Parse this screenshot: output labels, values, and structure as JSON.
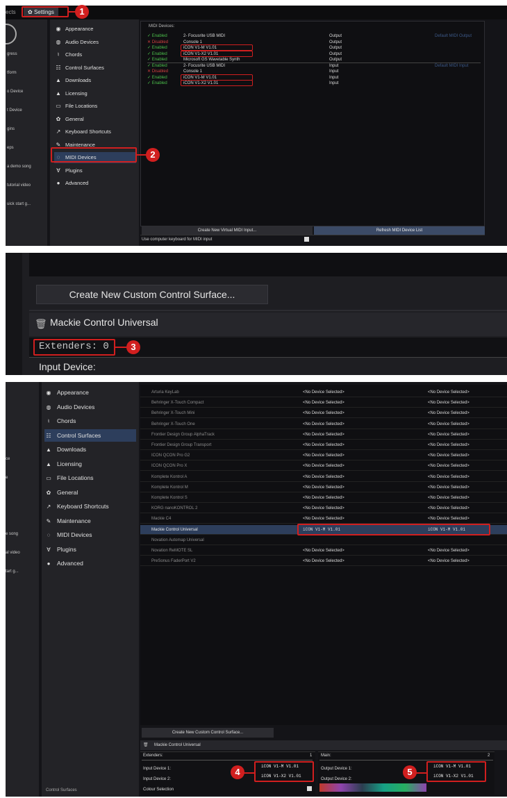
{
  "panel1": {
    "breadcrumb_frag": "ects",
    "settings_tab": "Settings",
    "left_items": [
      "gress",
      "tform",
      "o Device",
      "t Device",
      "gins",
      "eps",
      "a demo song",
      "tutorial video",
      "uick start g..."
    ],
    "menu": [
      {
        "icon": "eye-icon",
        "glyph": "◉",
        "label": "Appearance"
      },
      {
        "icon": "speaker-icon",
        "glyph": "◍",
        "label": "Audio Devices"
      },
      {
        "icon": "music-icon",
        "glyph": "♮",
        "label": "Chords"
      },
      {
        "icon": "sliders-icon",
        "glyph": "☷",
        "label": "Control Surfaces"
      },
      {
        "icon": "download-icon",
        "glyph": "▲",
        "label": "Downloads"
      },
      {
        "icon": "lock-icon",
        "glyph": "▲",
        "label": "Licensing"
      },
      {
        "icon": "folder-icon",
        "glyph": "▭",
        "label": "File Locations"
      },
      {
        "icon": "gear-icon",
        "glyph": "✿",
        "label": "General"
      },
      {
        "icon": "external-icon",
        "glyph": "↗",
        "label": "Keyboard Shortcuts"
      },
      {
        "icon": "wrench-icon",
        "glyph": "✎",
        "label": "Maintenance"
      },
      {
        "icon": "midi-icon",
        "glyph": "◌",
        "label": "MIDI Devices"
      },
      {
        "icon": "plug-icon",
        "glyph": "∀",
        "label": "Plugins"
      },
      {
        "icon": "advanced-icon",
        "glyph": "●",
        "label": "Advanced"
      }
    ],
    "midi_header": "MIDI Devices:",
    "devices": [
      {
        "status": "✓ Enabled",
        "name": "2- Focusrite USB MIDI",
        "dir": "Output",
        "extra": "Default MIDI Output",
        "ok": true
      },
      {
        "status": "✕ Disabled",
        "name": "Console 1",
        "dir": "Output",
        "extra": "",
        "ok": false
      },
      {
        "status": "✓ Enabled",
        "name": "iCON V1-M V1.01",
        "dir": "Output",
        "extra": "",
        "ok": true
      },
      {
        "status": "✓ Enabled",
        "name": "iCON V1-X2 V1.01",
        "dir": "Output",
        "extra": "",
        "ok": true
      },
      {
        "status": "✓ Enabled",
        "name": "Microsoft GS Wavetable Synth",
        "dir": "Output",
        "extra": "",
        "ok": true
      },
      {
        "status": "✓ Enabled",
        "name": "2- Focusrite USB MIDI",
        "dir": "Input",
        "extra": "Default MIDI Input",
        "ok": true
      },
      {
        "status": "✕ Disabled",
        "name": "Console 1",
        "dir": "Input",
        "extra": "",
        "ok": false
      },
      {
        "status": "✓ Enabled",
        "name": "iCON V1-M V1.01",
        "dir": "Input",
        "extra": "",
        "ok": true
      },
      {
        "status": "✓ Enabled",
        "name": "iCON V1-X2 V1.01",
        "dir": "Input",
        "extra": "",
        "ok": true
      }
    ],
    "create_virtual_btn": "Create New Virtual MIDI Input...",
    "refresh_btn": "Refresh MIDI Device List",
    "use_keyboard": "Use computer keyboard for MIDI input"
  },
  "panel2": {
    "create_surface_btn": "Create New Custom Control Surface...",
    "surface_title": "Mackie Control Universal",
    "extenders": "Extenders: 0",
    "input_device": "Input Device:"
  },
  "panel3": {
    "left_items": [
      "",
      "ce",
      "e",
      "",
      "",
      "e song",
      "al video",
      "tart g..."
    ],
    "active_menu": "Control Surfaces",
    "surfaces": [
      {
        "name": "Arturia KeyLab",
        "in": "<No Device Selected>",
        "out": "<No Device Selected>"
      },
      {
        "name": "Behringer X-Touch Compact",
        "in": "<No Device Selected>",
        "out": "<No Device Selected>"
      },
      {
        "name": "Behringer X-Touch Mini",
        "in": "<No Device Selected>",
        "out": "<No Device Selected>"
      },
      {
        "name": "Behringer X-Touch One",
        "in": "<No Device Selected>",
        "out": "<No Device Selected>"
      },
      {
        "name": "Frontier Design Group AlphaTrack",
        "in": "<No Device Selected>",
        "out": "<No Device Selected>"
      },
      {
        "name": "Frontier Design Group Transport",
        "in": "<No Device Selected>",
        "out": "<No Device Selected>"
      },
      {
        "name": "ICON QCON Pro G2",
        "in": "<No Device Selected>",
        "out": "<No Device Selected>"
      },
      {
        "name": "ICON QCON Pro X",
        "in": "<No Device Selected>",
        "out": "<No Device Selected>"
      },
      {
        "name": "Komplete Kontrol A",
        "in": "<No Device Selected>",
        "out": "<No Device Selected>"
      },
      {
        "name": "Komplete Kontrol M",
        "in": "<No Device Selected>",
        "out": "<No Device Selected>"
      },
      {
        "name": "Komplete Kontrol S",
        "in": "<No Device Selected>",
        "out": "<No Device Selected>"
      },
      {
        "name": "KORG nanoKONTROL 2",
        "in": "<No Device Selected>",
        "out": "<No Device Selected>"
      },
      {
        "name": "Mackie C4",
        "in": "<No Device Selected>",
        "out": "<No Device Selected>"
      },
      {
        "name": "Mackie Control Universal",
        "in": "iCON V1-M V1.01",
        "out": "iCON V1-M V1.01"
      },
      {
        "name": "Novation Automap Universal",
        "in": "",
        "out": ""
      },
      {
        "name": "Novation ReMOTE SL",
        "in": "<No Device Selected>",
        "out": "<No Device Selected>"
      },
      {
        "name": "PreSonus FaderPort V2",
        "in": "<No Device Selected>",
        "out": "<No Device Selected>"
      }
    ],
    "create_surface_btn": "Create New Custom Control Surface...",
    "surface_title": "Mackie Control Universal",
    "extenders_label": "Extenders:",
    "extenders_value": "1",
    "main_label": "Main:",
    "main_value": "2",
    "input1_label": "Input Device 1:",
    "input1_value": "iCON V1-M V1.01",
    "input2_label": "Input Device 2:",
    "input2_value": "iCON V1-X2 V1.01",
    "colour_label": "Colour Selection",
    "output1_label": "Output Device 1:",
    "output1_value": "iCON V1-M V1.01",
    "output2_label": "Output Device 2:",
    "output2_value": "iCON V1-X2 V1.01",
    "footer": "Control Surfaces"
  },
  "callouts": [
    "1",
    "2",
    "3",
    "4",
    "5"
  ],
  "colors": {
    "accent_red": "#d11f1f",
    "enabled": "#4bbf4b",
    "disabled": "#d14040",
    "select": "#2d3e5c"
  }
}
